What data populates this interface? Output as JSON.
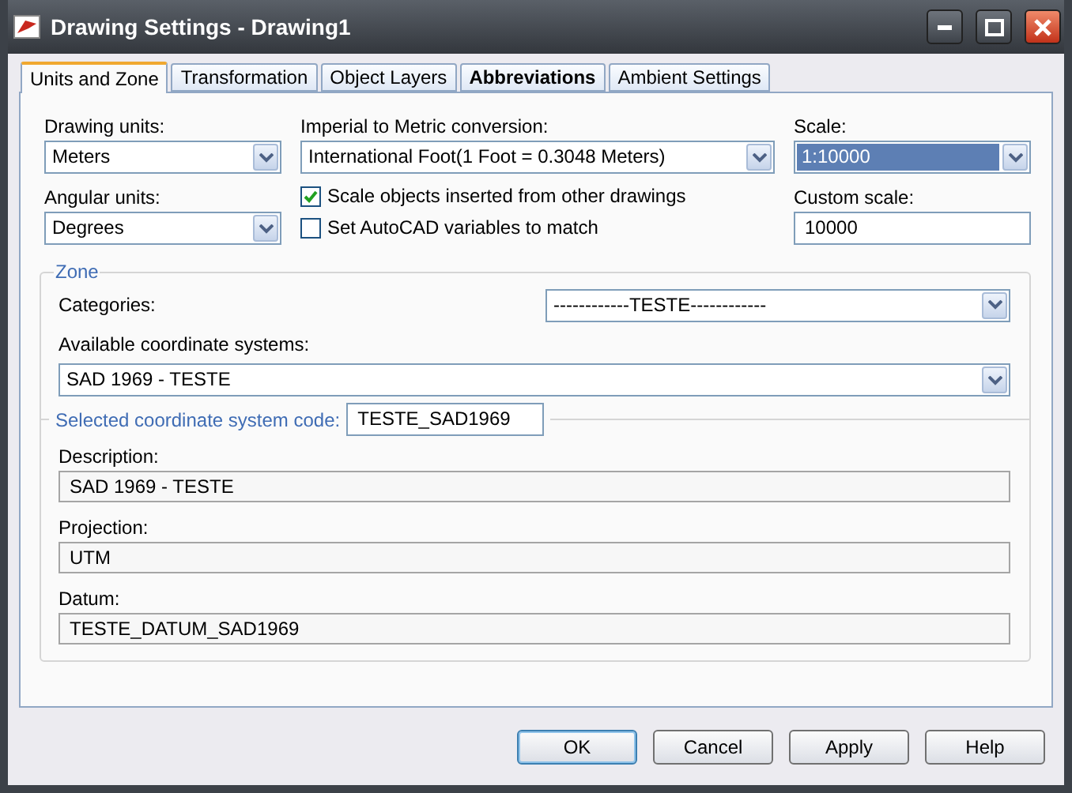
{
  "window": {
    "title": "Drawing Settings - Drawing1"
  },
  "tabs": [
    {
      "label": "Units and Zone",
      "selected": true,
      "emphasized": false
    },
    {
      "label": "Transformation",
      "selected": false,
      "emphasized": false
    },
    {
      "label": "Object Layers",
      "selected": false,
      "emphasized": false
    },
    {
      "label": "Abbreviations",
      "selected": false,
      "emphasized": true
    },
    {
      "label": "Ambient Settings",
      "selected": false,
      "emphasized": false
    }
  ],
  "drawing_units": {
    "label": "Drawing units:",
    "value": "Meters"
  },
  "conversion": {
    "label": "Imperial to Metric conversion:",
    "value": "International Foot(1 Foot = 0.3048 Meters)"
  },
  "scale": {
    "label": "Scale:",
    "value": "1:10000",
    "highlighted": true
  },
  "angular_units": {
    "label": "Angular units:",
    "value": "Degrees"
  },
  "checkboxes": [
    {
      "label": "Scale objects inserted from other drawings",
      "checked": true
    },
    {
      "label": "Set AutoCAD variables to match",
      "checked": false
    }
  ],
  "custom_scale": {
    "label": "Custom scale:",
    "value": "10000"
  },
  "zone": {
    "title": "Zone",
    "categories": {
      "label": "Categories:",
      "value": "------------TESTE------------"
    },
    "coordinate_systems": {
      "label": "Available coordinate systems:",
      "value": "SAD 1969 - TESTE"
    },
    "selected_code": {
      "label": "Selected coordinate system code:",
      "value": "TESTE_SAD1969"
    },
    "details": [
      {
        "label": "Description:",
        "value": "SAD 1969 - TESTE"
      },
      {
        "label": "Projection:",
        "value": "UTM"
      },
      {
        "label": "Datum:",
        "value": "TESTE_DATUM_SAD1969"
      }
    ]
  },
  "buttons": [
    {
      "label": "OK",
      "default": true
    },
    {
      "label": "Cancel",
      "default": false
    },
    {
      "label": "Apply",
      "default": false
    },
    {
      "label": "Help",
      "default": false
    }
  ]
}
